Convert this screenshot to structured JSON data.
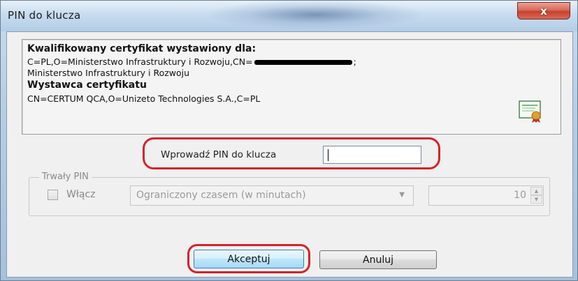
{
  "window": {
    "title": "PIN do klucza",
    "close_symbol": "x"
  },
  "certificate": {
    "subject_heading": "Kwalifikowany certyfikat wystawiony dla:",
    "subject_line1_before": "C=PL,O=Ministerstwo Infrastruktury i Rozwoju,CN=",
    "subject_line1_after": ";",
    "subject_line2": "Ministerstwo Infrastruktury i Rozwoju",
    "issuer_heading": "Wystawca certyfikatu",
    "issuer_line": "CN=CERTUM QCA,O=Unizeto Technologies S.A.,C=PL",
    "icon": "certificate-icon"
  },
  "pin": {
    "label": "Wprowadź PIN do klucza",
    "value": ""
  },
  "persistent_pin": {
    "group_title": "Trwały PIN",
    "checkbox_label": "Włącz",
    "checked": false,
    "mode_selected": "Ograniczony czasem (w minutach)",
    "minutes": "10"
  },
  "buttons": {
    "accept": "Akceptuj",
    "cancel": "Anuluj"
  },
  "colors": {
    "highlight": "#d4242a",
    "close_button": "#c7402f"
  }
}
